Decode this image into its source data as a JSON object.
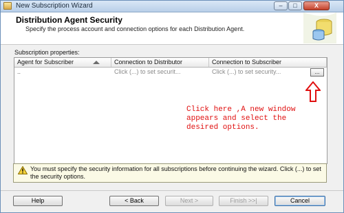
{
  "window": {
    "title": "New Subscription Wizard",
    "controls": {
      "minimize": "–",
      "maximize": "□",
      "close": "X"
    }
  },
  "header": {
    "title": "Distribution Agent Security",
    "subtitle": "Specify the process account and connection options for each Distribution Agent."
  },
  "properties": {
    "label": "Subscription properties:",
    "columns": [
      "Agent for Subscriber",
      "Connection to Distributor",
      "Connection to Subscriber"
    ],
    "rows": [
      {
        "agent": "..",
        "distributor": "Click (...) to set securit...",
        "subscriber": "Click (...) to set security...",
        "button": "..."
      }
    ]
  },
  "annotation": {
    "text": "Click here ,A new window appears and select the desired options.",
    "color": "#e01010"
  },
  "warning": {
    "text": "You must specify the security information for all subscriptions before continuing the wizard. Click (...) to set the security options."
  },
  "footer": {
    "help": "Help",
    "back": "< Back",
    "next": "Next >",
    "finish": "Finish >>|",
    "cancel": "Cancel"
  },
  "icons": {
    "app": "wizard-icon",
    "header": "database-users-icon",
    "warning": "warning-icon",
    "arrow": "up-arrow-icon"
  }
}
